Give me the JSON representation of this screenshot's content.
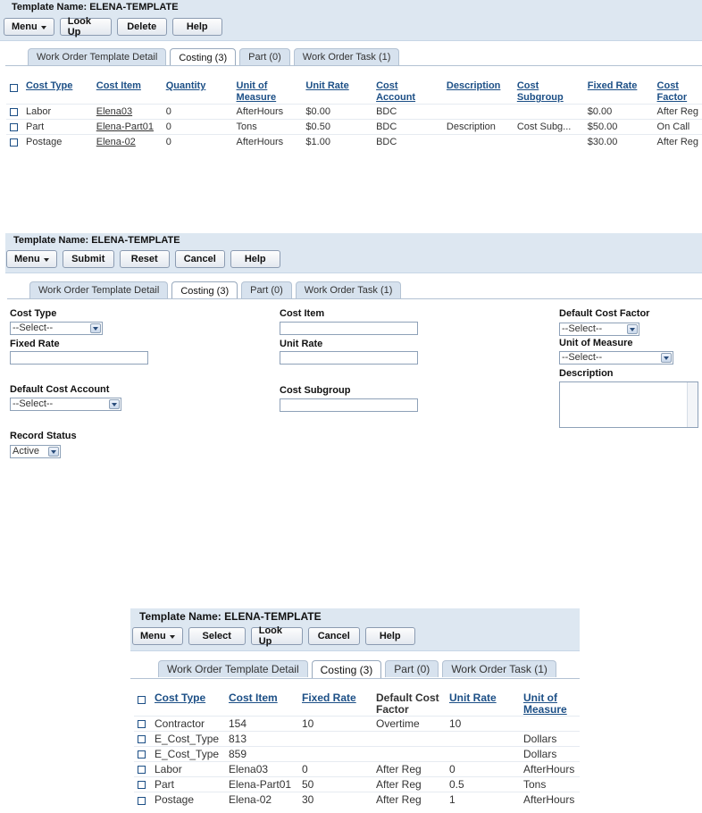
{
  "p1": {
    "title": "Template Name: ELENA-TEMPLATE",
    "buttons": {
      "menu": "Menu",
      "lookup": "Look Up",
      "delete": "Delete",
      "help": "Help"
    },
    "tabs": [
      "Work Order Template Detail",
      "Costing (3)",
      "Part (0)",
      "Work Order Task (1)"
    ],
    "columns": [
      "Cost Type",
      "Cost Item",
      "Quantity",
      "Unit of Measure",
      "Unit Rate",
      "Cost Account",
      "Description",
      "Cost Subgroup",
      "Fixed Rate",
      "Cost Factor"
    ],
    "rows": [
      [
        "Labor",
        "Elena03",
        "0",
        "AfterHours",
        "$0.00",
        "BDC",
        "",
        "",
        "$0.00",
        "After Reg"
      ],
      [
        "Part",
        "Elena-Part01",
        "0",
        "Tons",
        "$0.50",
        "BDC",
        "Description",
        "Cost Subg...",
        "$50.00",
        "On Call"
      ],
      [
        "Postage",
        "Elena-02",
        "0",
        "AfterHours",
        "$1.00",
        "BDC",
        "",
        "",
        "$30.00",
        "After Reg"
      ]
    ]
  },
  "p2": {
    "title": "Template Name: ELENA-TEMPLATE",
    "buttons": {
      "menu": "Menu",
      "submit": "Submit",
      "reset": "Reset",
      "cancel": "Cancel",
      "help": "Help"
    },
    "tabs": [
      "Work Order Template Detail",
      "Costing (3)",
      "Part (0)",
      "Work Order Task (1)"
    ],
    "form": {
      "cost_type_label": "Cost Type",
      "cost_type_value": "--Select--",
      "fixed_rate_label": "Fixed Rate",
      "default_cost_account_label": "Default Cost Account",
      "default_cost_account_value": "--Select--",
      "record_status_label": "Record Status",
      "record_status_value": "Active",
      "cost_item_label": "Cost Item",
      "unit_rate_label": "Unit Rate",
      "cost_subgroup_label": "Cost Subgroup",
      "default_cost_factor_label": "Default Cost Factor",
      "default_cost_factor_value": "--Select--",
      "unit_of_measure_label": "Unit of Measure",
      "unit_of_measure_value": "--Select--",
      "description_label": "Description"
    }
  },
  "p3": {
    "title": "Template Name: ELENA-TEMPLATE",
    "buttons": {
      "menu": "Menu",
      "select": "Select",
      "lookup": "Look Up",
      "cancel": "Cancel",
      "help": "Help"
    },
    "tabs": [
      "Work Order Template Detail",
      "Costing (3)",
      "Part (0)",
      "Work Order Task (1)"
    ],
    "columns": [
      "Cost Type",
      "Cost Item",
      "Fixed Rate",
      "Default Cost Factor",
      "Unit Rate",
      "Unit of Measure"
    ],
    "rows": [
      [
        "Contractor",
        "154",
        "10",
        "Overtime",
        "10",
        ""
      ],
      [
        "E_Cost_Type",
        "813",
        "",
        "",
        "",
        "Dollars"
      ],
      [
        "E_Cost_Type",
        "859",
        "",
        "",
        "",
        "Dollars"
      ],
      [
        "Labor",
        "Elena03",
        "0",
        "After Reg",
        "0",
        "AfterHours"
      ],
      [
        "Part",
        "Elena-Part01",
        "50",
        "After Reg",
        "0.5",
        "Tons"
      ],
      [
        "Postage",
        "Elena-02",
        "30",
        "After Reg",
        "1",
        "AfterHours"
      ]
    ]
  }
}
